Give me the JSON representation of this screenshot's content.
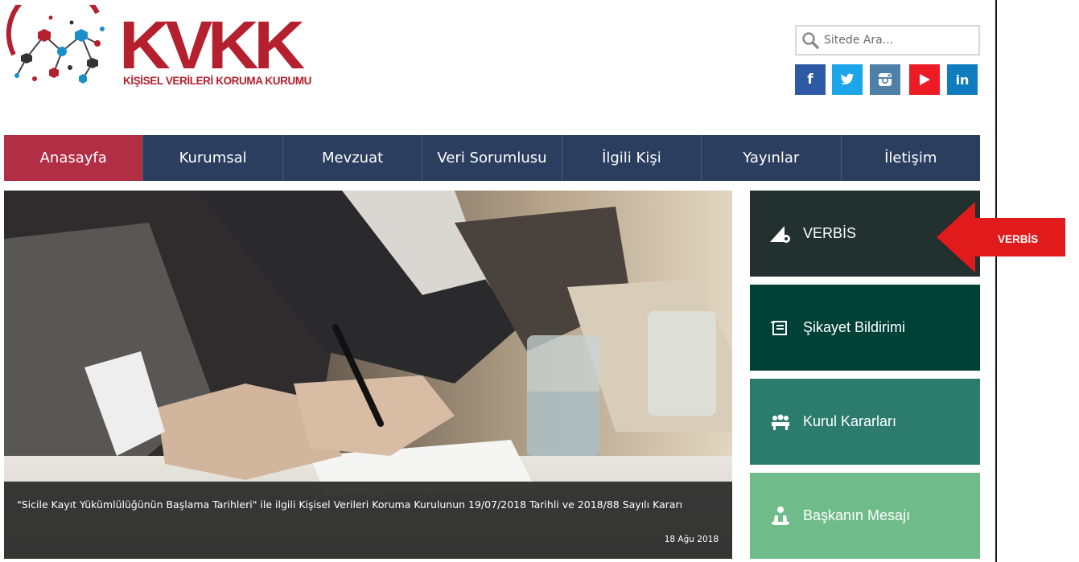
{
  "logo": {
    "title": "KVKK",
    "subtitle": "KİŞİSEL VERİLERİ KORUMA KURUMU"
  },
  "search": {
    "placeholder": "Sitede Ara..."
  },
  "social": {
    "facebook": "f",
    "twitter": "twitter-icon",
    "instagram": "instagram-icon",
    "youtube": "youtube-icon",
    "linkedin": "in"
  },
  "nav": {
    "items": [
      "Anasayfa",
      "Kurumsal",
      "Mevzuat",
      "Veri Sorumlusu",
      "İlgili Kişi",
      "Yayınlar",
      "İletişim"
    ],
    "active": "Anasayfa"
  },
  "hero": {
    "caption": "\"Sicile Kayıt Yükümlülüğünün Başlama Tarihleri\" ile ilgili Kişisel Verileri Koruma Kurulunun 19/07/2018 Tarihli ve 2018/88 Sayılı Kararı",
    "date": "18 Ağu 2018"
  },
  "tiles": [
    {
      "label": "VERBİS",
      "icon": "verbis-icon"
    },
    {
      "label": "Şikayet Bildirimi",
      "icon": "complaint-icon"
    },
    {
      "label": "Kurul Kararları",
      "icon": "board-icon"
    },
    {
      "label": "Başkanın Mesajı",
      "icon": "president-icon"
    }
  ],
  "annotation": {
    "label": "VERBİS"
  },
  "colors": {
    "brand": "#b4202d",
    "nav_bg": "#2c3e5f",
    "nav_active": "#b22e45",
    "tile1": "#22302f",
    "tile2": "#004137",
    "tile3": "#2c7c6e",
    "tile4": "#6fbb8a",
    "arrow": "#e11b1b"
  }
}
